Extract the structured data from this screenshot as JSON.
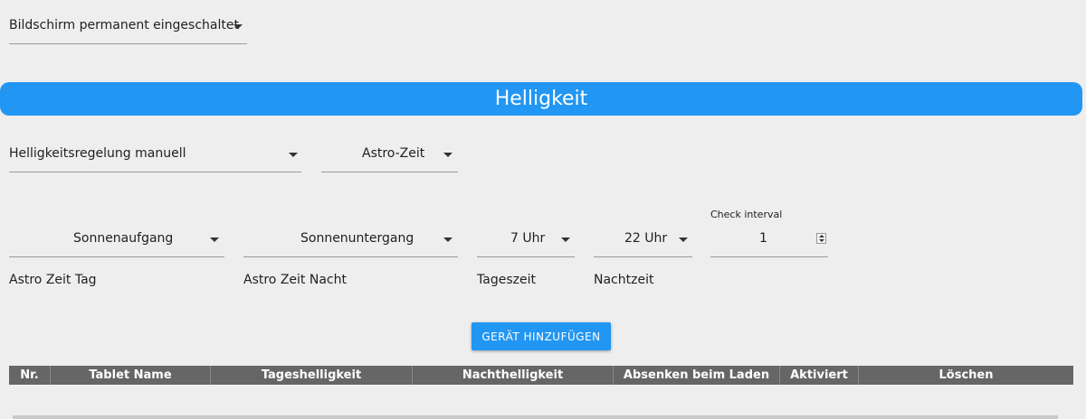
{
  "screen_mode": {
    "value": "Bildschirm permanent eingeschaltet"
  },
  "section": {
    "title": "Helligkeit"
  },
  "brightness": {
    "mode_value": "Helligkeitsregelung manuell",
    "time_type_value": "Astro-Zeit"
  },
  "astro": {
    "day_select": "Sonnenaufgang",
    "night_select": "Sonnenuntergang",
    "day_time_select": "7 Uhr",
    "night_time_select": "22 Uhr",
    "check_interval_label": "Check interval",
    "check_interval_value": "1",
    "day_label": "Astro Zeit Tag",
    "night_label": "Astro Zeit Nacht",
    "daytime_label": "Tageszeit",
    "nighttime_label": "Nachtzeit"
  },
  "actions": {
    "add_device": "GERÄT HINZUFÜGEN"
  },
  "table": {
    "headers": [
      "Nr.",
      "Tablet Name",
      "Tageshelligkeit",
      "Nachthelligkeit",
      "Absenken beim Laden",
      "Aktiviert",
      "Löschen"
    ]
  },
  "icons": {
    "dropdown": "chevron-down-icon",
    "stepper": "stepper-icon"
  },
  "colors": {
    "accent": "#2196f3",
    "table_header": "#666666",
    "background": "#eeeeee"
  }
}
